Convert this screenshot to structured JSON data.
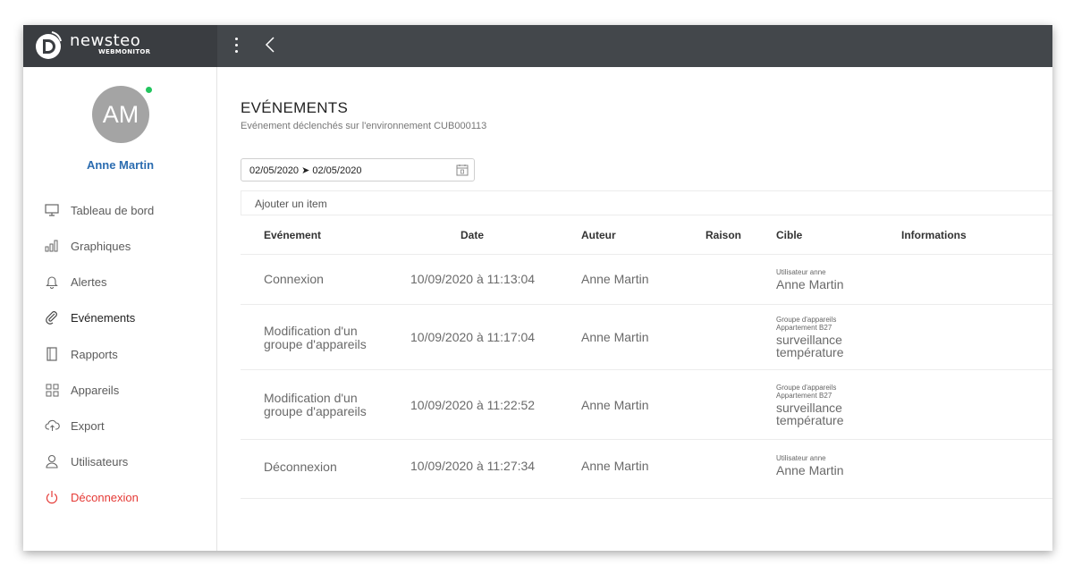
{
  "brand": {
    "name": "newsteo",
    "sub": "WEBMONITOR"
  },
  "user": {
    "initials": "AM",
    "name": "Anne Martin"
  },
  "nav": [
    {
      "label": "Tableau de bord",
      "icon": "monitor-icon"
    },
    {
      "label": "Graphiques",
      "icon": "bar-chart-icon"
    },
    {
      "label": "Alertes",
      "icon": "bell-icon"
    },
    {
      "label": "Evénements",
      "icon": "paperclip-icon"
    },
    {
      "label": "Rapports",
      "icon": "document-icon"
    },
    {
      "label": "Appareils",
      "icon": "grid-icon"
    },
    {
      "label": "Export",
      "icon": "cloud-upload-icon"
    },
    {
      "label": "Utilisateurs",
      "icon": "user-icon"
    },
    {
      "label": "Déconnexion",
      "icon": "power-icon"
    }
  ],
  "page": {
    "title": "EVÉNEMENTS",
    "subtitle": "Evénement déclenchés sur l'environnement CUB000113",
    "date_range": "02/05/2020 ➤ 02/05/2020",
    "add_item": "Ajouter un item"
  },
  "table": {
    "headers": [
      "Evénement",
      "Date",
      "Auteur",
      "Raison",
      "Cible",
      "Informations"
    ],
    "rows": [
      {
        "event": "Connexion",
        "date": "10/09/2020 à 11:13:04",
        "author": "Anne Martin",
        "reason": "",
        "cible_sub": [
          "Utilisateur anne"
        ],
        "cible_main": "Anne Martin",
        "info": ""
      },
      {
        "event": "Modification d'un groupe d'appareils",
        "date": "10/09/2020 à 11:17:04",
        "author": "Anne Martin",
        "reason": "",
        "cible_sub": [
          "Groupe d'appareils",
          "Appartement B27"
        ],
        "cible_main": "surveillance température",
        "info": ""
      },
      {
        "event": "Modification d'un groupe d'appareils",
        "date": "10/09/2020 à 11:22:52",
        "author": "Anne Martin",
        "reason": "",
        "cible_sub": [
          "Groupe d'appareils",
          "Appartement B27"
        ],
        "cible_main": "surveillance température",
        "info": ""
      },
      {
        "event": "Déconnexion",
        "date": "10/09/2020 à 11:27:34",
        "author": "Anne Martin",
        "reason": "",
        "cible_sub": [
          "Utilisateur anne"
        ],
        "cible_main": "Anne Martin",
        "info": ""
      }
    ]
  },
  "colors": {
    "topbar": "#43474b",
    "accent": "#2b6cb0",
    "online": "#22c55e",
    "logout": "#e53935"
  }
}
